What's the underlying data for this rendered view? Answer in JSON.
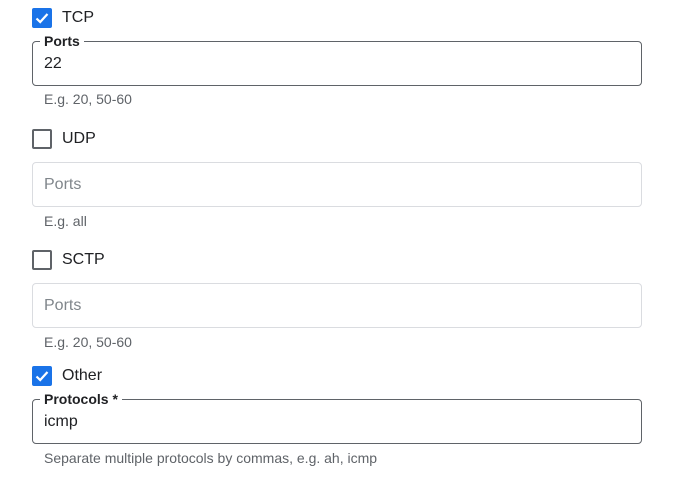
{
  "tcp": {
    "label": "TCP",
    "checked": true,
    "field_label": "Ports",
    "value": "22",
    "hint": "E.g. 20, 50-60"
  },
  "udp": {
    "label": "UDP",
    "checked": false,
    "placeholder": "Ports",
    "hint": "E.g. all"
  },
  "sctp": {
    "label": "SCTP",
    "checked": false,
    "placeholder": "Ports",
    "hint": "E.g. 20, 50-60"
  },
  "other": {
    "label": "Other",
    "checked": true,
    "field_label": "Protocols *",
    "value": "icmp",
    "hint": "Separate multiple protocols by commas, e.g. ah, icmp"
  },
  "colors": {
    "accent": "#1a73e8",
    "border": "#5f6368",
    "empty_border": "#dadce0",
    "hint": "#5f6368"
  }
}
